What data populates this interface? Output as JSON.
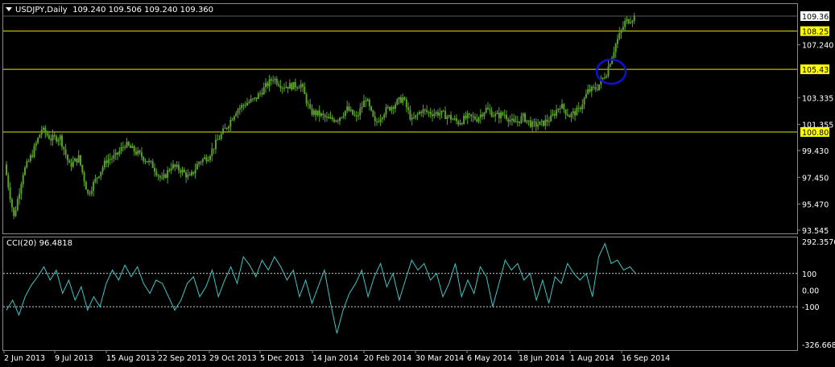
{
  "chart_title": {
    "symbol": "USDJPY,Daily",
    "ohlc": "109.240 109.506 109.240 109.360"
  },
  "indicator_title": "CCI(20) 96.4818",
  "colors": {
    "background": "#000000",
    "candle": "#5aa02c",
    "level_line": "#e6e600",
    "level_tag": "#ffff00",
    "cci": "#3ec6c6",
    "circle": "#1010d0",
    "frame": "#8a8a8a"
  },
  "chart_data": [
    {
      "type": "candlestick",
      "title": "USDJPY,Daily",
      "price_scale_labels": [
        "109.360",
        "108.250",
        "107.240",
        "105.430",
        "103.335",
        "101.355",
        "100.800",
        "99.430",
        "97.450",
        "95.470",
        "93.545"
      ],
      "ylim": [
        93.545,
        109.7
      ],
      "x_labels": [
        "2 Jun 2013",
        "9 Jul 2013",
        "15 Aug 2013",
        "22 Sep 2013",
        "29 Oct 2013",
        "5 Dec 2013",
        "14 Jan 2014",
        "20 Feb 2014",
        "30 Mar 2014",
        "6 May 2014",
        "18 Jun 2014",
        "1 Aug 2014",
        "16 Sep 2014"
      ],
      "horizontal_levels": [
        108.25,
        105.43,
        100.8
      ],
      "highlighted_levels": [
        "108.250",
        "105.430",
        "100.800"
      ],
      "current_price": "109.360",
      "marker": {
        "shape": "circle",
        "near_date": "29 Aug 2014",
        "price": 105.43
      },
      "closes_weekly": [
        {
          "x": "2 Jun 2013",
          "close": 98.4
        },
        {
          "x": "10 Jun 2013",
          "close": 94.5
        },
        {
          "x": "17 Jun 2013",
          "close": 97.8
        },
        {
          "x": "24 Jun 2013",
          "close": 99.2
        },
        {
          "x": "1 Jul 2013",
          "close": 101.0
        },
        {
          "x": "8 Jul 2013",
          "close": 100.3
        },
        {
          "x": "15 Jul 2013",
          "close": 100.4
        },
        {
          "x": "22 Jul 2013",
          "close": 98.3
        },
        {
          "x": "29 Jul 2013",
          "close": 98.9
        },
        {
          "x": "5 Aug 2013",
          "close": 96.2
        },
        {
          "x": "12 Aug 2013",
          "close": 97.5
        },
        {
          "x": "19 Aug 2013",
          "close": 98.7
        },
        {
          "x": "26 Aug 2013",
          "close": 99.0
        },
        {
          "x": "2 Sep 2013",
          "close": 99.9
        },
        {
          "x": "9 Sep 2013",
          "close": 99.4
        },
        {
          "x": "16 Sep 2013",
          "close": 98.9
        },
        {
          "x": "23 Sep 2013",
          "close": 98.3
        },
        {
          "x": "30 Sep 2013",
          "close": 97.2
        },
        {
          "x": "7 Oct 2013",
          "close": 98.3
        },
        {
          "x": "14 Oct 2013",
          "close": 98.0
        },
        {
          "x": "21 Oct 2013",
          "close": 97.4
        },
        {
          "x": "28 Oct 2013",
          "close": 98.6
        },
        {
          "x": "4 Nov 2013",
          "close": 99.0
        },
        {
          "x": "11 Nov 2013",
          "close": 100.2
        },
        {
          "x": "18 Nov 2013",
          "close": 101.2
        },
        {
          "x": "25 Nov 2013",
          "close": 102.4
        },
        {
          "x": "2 Dec 2013",
          "close": 102.9
        },
        {
          "x": "9 Dec 2013",
          "close": 103.2
        },
        {
          "x": "16 Dec 2013",
          "close": 104.0
        },
        {
          "x": "23 Dec 2013",
          "close": 104.8
        },
        {
          "x": "30 Dec 2013",
          "close": 104.2
        },
        {
          "x": "6 Jan 2014",
          "close": 104.2
        },
        {
          "x": "13 Jan 2014",
          "close": 104.3
        },
        {
          "x": "20 Jan 2014",
          "close": 102.3
        },
        {
          "x": "27 Jan 2014",
          "close": 102.1
        },
        {
          "x": "3 Feb 2014",
          "close": 101.7
        },
        {
          "x": "10 Feb 2014",
          "close": 101.8
        },
        {
          "x": "17 Feb 2014",
          "close": 102.5
        },
        {
          "x": "24 Feb 2014",
          "close": 101.8
        },
        {
          "x": "3 Mar 2014",
          "close": 103.3
        },
        {
          "x": "10 Mar 2014",
          "close": 101.4
        },
        {
          "x": "17 Mar 2014",
          "close": 102.3
        },
        {
          "x": "24 Mar 2014",
          "close": 102.8
        },
        {
          "x": "31 Mar 2014",
          "close": 103.3
        },
        {
          "x": "7 Apr 2014",
          "close": 101.6
        },
        {
          "x": "14 Apr 2014",
          "close": 102.4
        },
        {
          "x": "21 Apr 2014",
          "close": 102.2
        },
        {
          "x": "28 Apr 2014",
          "close": 102.2
        },
        {
          "x": "5 May 2014",
          "close": 101.9
        },
        {
          "x": "12 May 2014",
          "close": 101.5
        },
        {
          "x": "19 May 2014",
          "close": 101.9
        },
        {
          "x": "26 May 2014",
          "close": 101.8
        },
        {
          "x": "2 Jun 2014",
          "close": 102.5
        },
        {
          "x": "9 Jun 2014",
          "close": 102.0
        },
        {
          "x": "16 Jun 2014",
          "close": 102.1
        },
        {
          "x": "23 Jun 2014",
          "close": 101.4
        },
        {
          "x": "30 Jun 2014",
          "close": 101.9
        },
        {
          "x": "7 Jul 2014",
          "close": 101.3
        },
        {
          "x": "14 Jul 2014",
          "close": 101.4
        },
        {
          "x": "21 Jul 2014",
          "close": 101.8
        },
        {
          "x": "28 Jul 2014",
          "close": 102.8
        },
        {
          "x": "4 Aug 2014",
          "close": 102.0
        },
        {
          "x": "11 Aug 2014",
          "close": 102.4
        },
        {
          "x": "18 Aug 2014",
          "close": 103.8
        },
        {
          "x": "25 Aug 2014",
          "close": 104.1
        },
        {
          "x": "1 Sep 2014",
          "close": 105.2
        },
        {
          "x": "8 Sep 2014",
          "close": 107.3
        },
        {
          "x": "15 Sep 2014",
          "close": 108.9
        },
        {
          "x": "22 Sep 2014",
          "close": 109.3
        }
      ]
    },
    {
      "type": "line",
      "title": "CCI(20) 96.4818",
      "y_scale_labels": [
        "292.3576",
        "100",
        "0.00",
        "-100",
        "-326.6682"
      ],
      "ylim": [
        -326.6682,
        292.3576
      ],
      "reference_levels": [
        100,
        -100
      ],
      "series": [
        {
          "name": "CCI(20)",
          "values": [
            -120,
            -60,
            -150,
            -40,
            30,
            80,
            140,
            60,
            120,
            -20,
            60,
            -60,
            20,
            -120,
            -40,
            -100,
            40,
            120,
            60,
            150,
            80,
            140,
            40,
            -20,
            60,
            40,
            -40,
            -120,
            -60,
            40,
            80,
            -40,
            20,
            120,
            -40,
            60,
            140,
            40,
            200,
            150,
            80,
            180,
            120,
            200,
            140,
            60,
            120,
            -40,
            60,
            -80,
            20,
            120,
            -80,
            -260,
            -120,
            -20,
            40,
            120,
            -40,
            80,
            160,
            20,
            100,
            -60,
            60,
            180,
            120,
            160,
            60,
            100,
            -40,
            40,
            160,
            -40,
            60,
            -20,
            140,
            80,
            -100,
            40,
            180,
            120,
            160,
            60,
            100,
            -60,
            60,
            -80,
            80,
            40,
            160,
            100,
            60,
            100,
            -40,
            200,
            280,
            160,
            180,
            120,
            140,
            96
          ]
        }
      ]
    }
  ]
}
